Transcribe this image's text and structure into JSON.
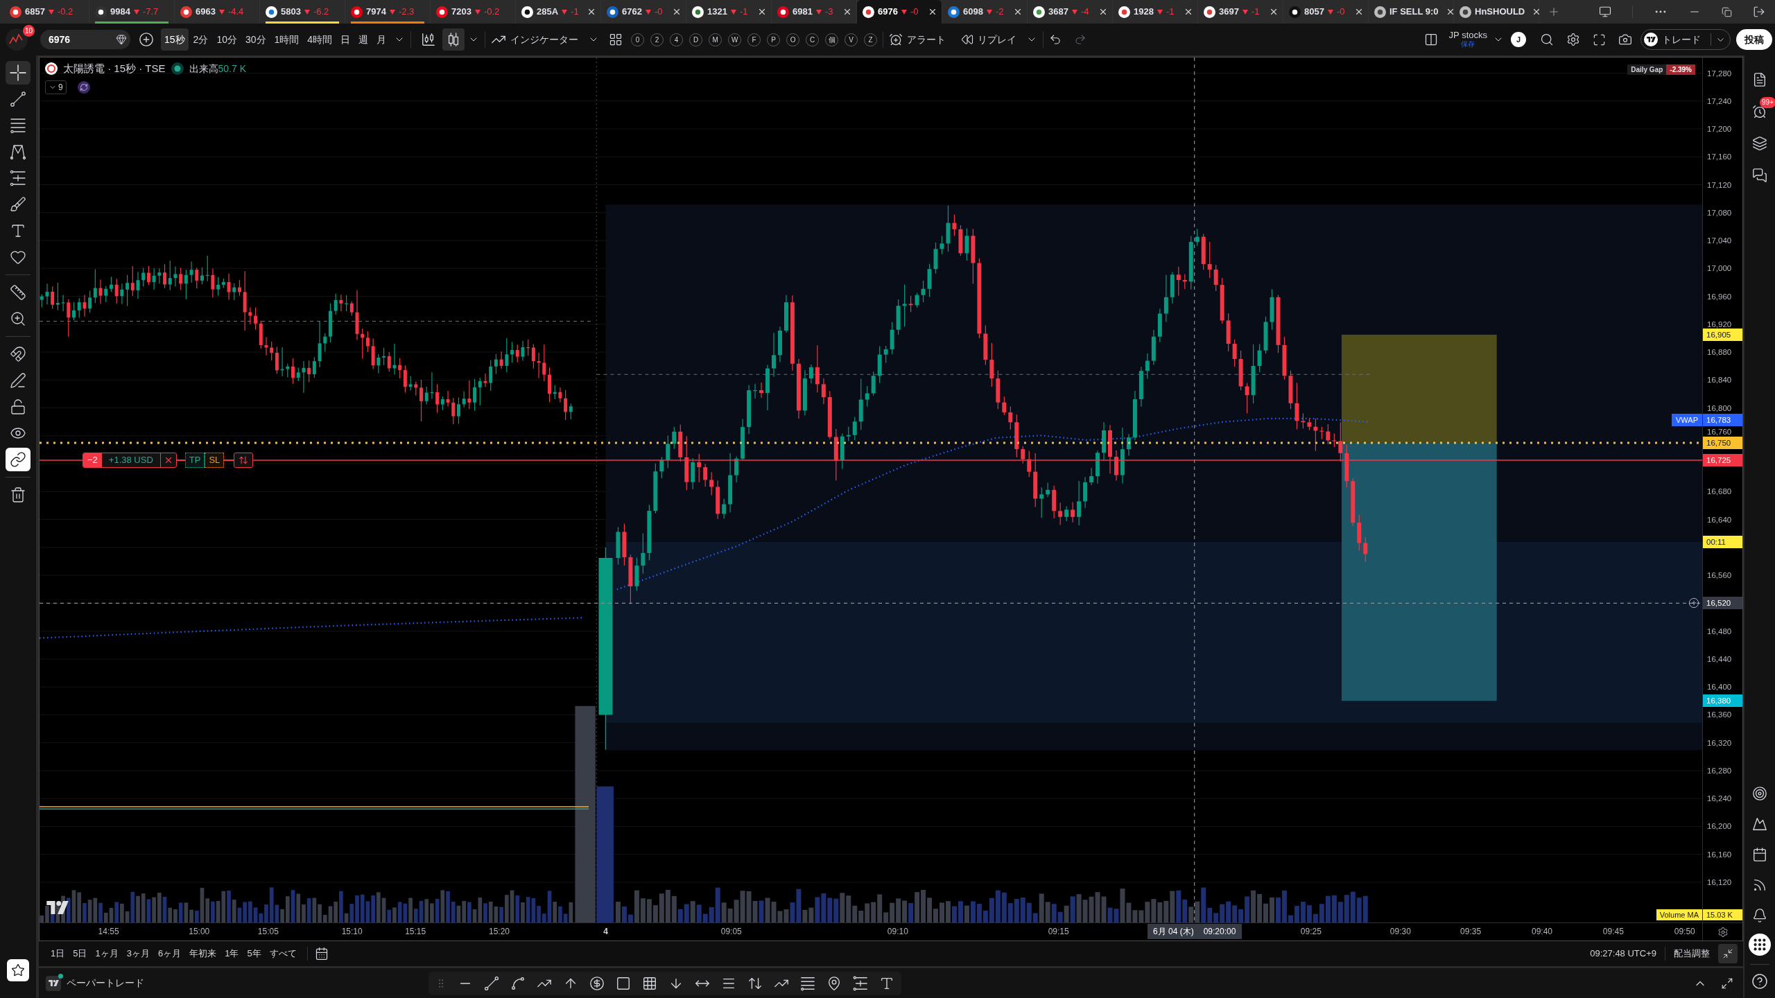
{
  "browser_tabs": [
    {
      "title": "6857",
      "change": "-0.2",
      "closable": false,
      "selected": false
    },
    {
      "title": "9984",
      "change": "-7.7",
      "closable": false,
      "selected": false,
      "color": "#4caf50"
    },
    {
      "title": "6963",
      "change": "-4.4",
      "closable": false,
      "selected": false
    },
    {
      "title": "5803",
      "change": "-6.2",
      "closable": false,
      "selected": false,
      "color": "#fdd835"
    },
    {
      "title": "7974",
      "change": "-2.3",
      "closable": false,
      "selected": false,
      "color": "#f57c00"
    },
    {
      "title": "7203",
      "change": "-0.2",
      "closable": false,
      "selected": false
    },
    {
      "title": "285A",
      "change": "-1",
      "closable": true,
      "selected": false
    },
    {
      "title": "6762",
      "change": "-0",
      "closable": true,
      "selected": false
    },
    {
      "title": "1321",
      "change": "-1",
      "closable": true,
      "selected": false
    },
    {
      "title": "6981",
      "change": "-3",
      "closable": true,
      "selected": false
    },
    {
      "title": "6976",
      "change": "-0",
      "closable": true,
      "selected": true
    },
    {
      "title": "6098",
      "change": "-2",
      "closable": true,
      "selected": false
    },
    {
      "title": "3687",
      "change": "-4",
      "closable": true,
      "selected": false
    },
    {
      "title": "1928",
      "change": "-1",
      "closable": true,
      "selected": false
    },
    {
      "title": "3697",
      "change": "-1",
      "closable": true,
      "selected": false
    },
    {
      "title": "8057",
      "change": "-0",
      "closable": true,
      "selected": false
    },
    {
      "title": "IF SELL 9:0",
      "closable": true,
      "selected": false
    },
    {
      "title": "HnSHOULD",
      "closable": true,
      "selected": false
    }
  ],
  "toolbar": {
    "notifications": "10",
    "symbol": "6976",
    "intervals": [
      {
        "label": "15秒",
        "selected": true
      },
      {
        "label": "2分",
        "selected": false
      },
      {
        "label": "10分",
        "selected": false
      },
      {
        "label": "30分",
        "selected": false
      },
      {
        "label": "1時間",
        "selected": false
      },
      {
        "label": "4時間",
        "selected": false
      },
      {
        "label": "日",
        "selected": false
      },
      {
        "label": "週",
        "selected": false
      },
      {
        "label": "月",
        "selected": false
      }
    ],
    "chart_styles": [
      {
        "selected": false
      },
      {
        "selected": true
      }
    ],
    "indicators": "インジケーター",
    "hotkeys": [
      "0",
      "2",
      "4",
      "D",
      "M",
      "W",
      "F",
      "P",
      "O",
      "C",
      "個",
      "V",
      "Z"
    ],
    "alert": "アラート",
    "replay": "リプレイ",
    "layout_name": "JP stocks",
    "layout_status": "保存",
    "user_initial": "J",
    "trade": "トレード",
    "publish": "投稿"
  },
  "left_toolbar": {
    "tools": [
      {
        "selected": true
      },
      {
        "selected": false
      },
      {
        "selected": false
      },
      {
        "selected": false
      },
      {
        "selected": false
      },
      {
        "selected": false
      },
      {
        "selected": false
      },
      {
        "selected": false
      }
    ],
    "toggles": [
      {
        "on": false
      },
      {
        "on": false
      },
      {
        "on": false
      },
      {
        "on": false
      },
      {
        "on": true
      }
    ]
  },
  "right_sidebar": {
    "alerts_badge": "99+"
  },
  "chart": {
    "title": "太陽誘電 · 15秒 · TSE",
    "market_open": true,
    "volume_label": "出来高",
    "volume_value": "50.7 K",
    "indicator_count": "9",
    "daily_gap": {
      "label": "Daily Gap",
      "value": "-2.39%"
    },
    "order": {
      "quantity": "−2",
      "pnl": "+1.38 USD",
      "take_profit": "TP",
      "stop_loss": "SL"
    },
    "price_labels": [
      "17,280",
      "17,240",
      "17,200",
      "17,160",
      "17,120",
      "17,080",
      "17,040",
      "17,000",
      "16,960",
      "16,920",
      "16,880",
      "16,840",
      "16,800",
      "16,760",
      "16,680",
      "16,640",
      "16,560",
      "16,480",
      "16,440",
      "16,400",
      "16,360",
      "16,320",
      "16,280",
      "16,240",
      "16,200",
      "16,160",
      "16,120"
    ],
    "price_tags": [
      {
        "kind": "price",
        "text": "16,905",
        "color": "#ffeb3b"
      },
      {
        "kind": "price",
        "title": "VWAP",
        "text": "16,783",
        "color": "#2962ff"
      },
      {
        "kind": "price",
        "text": "16,750",
        "color": "#fbc02d"
      },
      {
        "kind": "price",
        "text": "16,725",
        "color": "#f23645"
      },
      {
        "kind": "price",
        "text": "00:11",
        "color": "#ffeb3b"
      },
      {
        "kind": "crosshair",
        "text": "16,520",
        "color": "#363a45"
      },
      {
        "kind": "price",
        "text": "16,380",
        "color": "#00bcd4"
      }
    ],
    "volume_ma": {
      "label": "Volume MA",
      "value": "15.03 K"
    },
    "time_labels": [
      "14:55",
      "15:00",
      "15:05",
      "15:10",
      "15:15",
      "15:20",
      "4",
      "09:05",
      "09:10",
      "09:15",
      "09:25",
      "09:30",
      "09:35",
      "09:40",
      "09:45",
      "09:50"
    ],
    "crosshair_date": "6月 04 (木)",
    "crosshair_time": "09:20:00"
  },
  "date_range": {
    "ranges": [
      "1日",
      "5日",
      "1ヶ月",
      "3ヶ月",
      "6ヶ月",
      "年初来",
      "1年",
      "5年",
      "すべて"
    ],
    "clock": "09:27:48 UTC+9",
    "adjustment": "配当調整"
  },
  "bottom_panel": {
    "title": "ペーパートレード"
  }
}
